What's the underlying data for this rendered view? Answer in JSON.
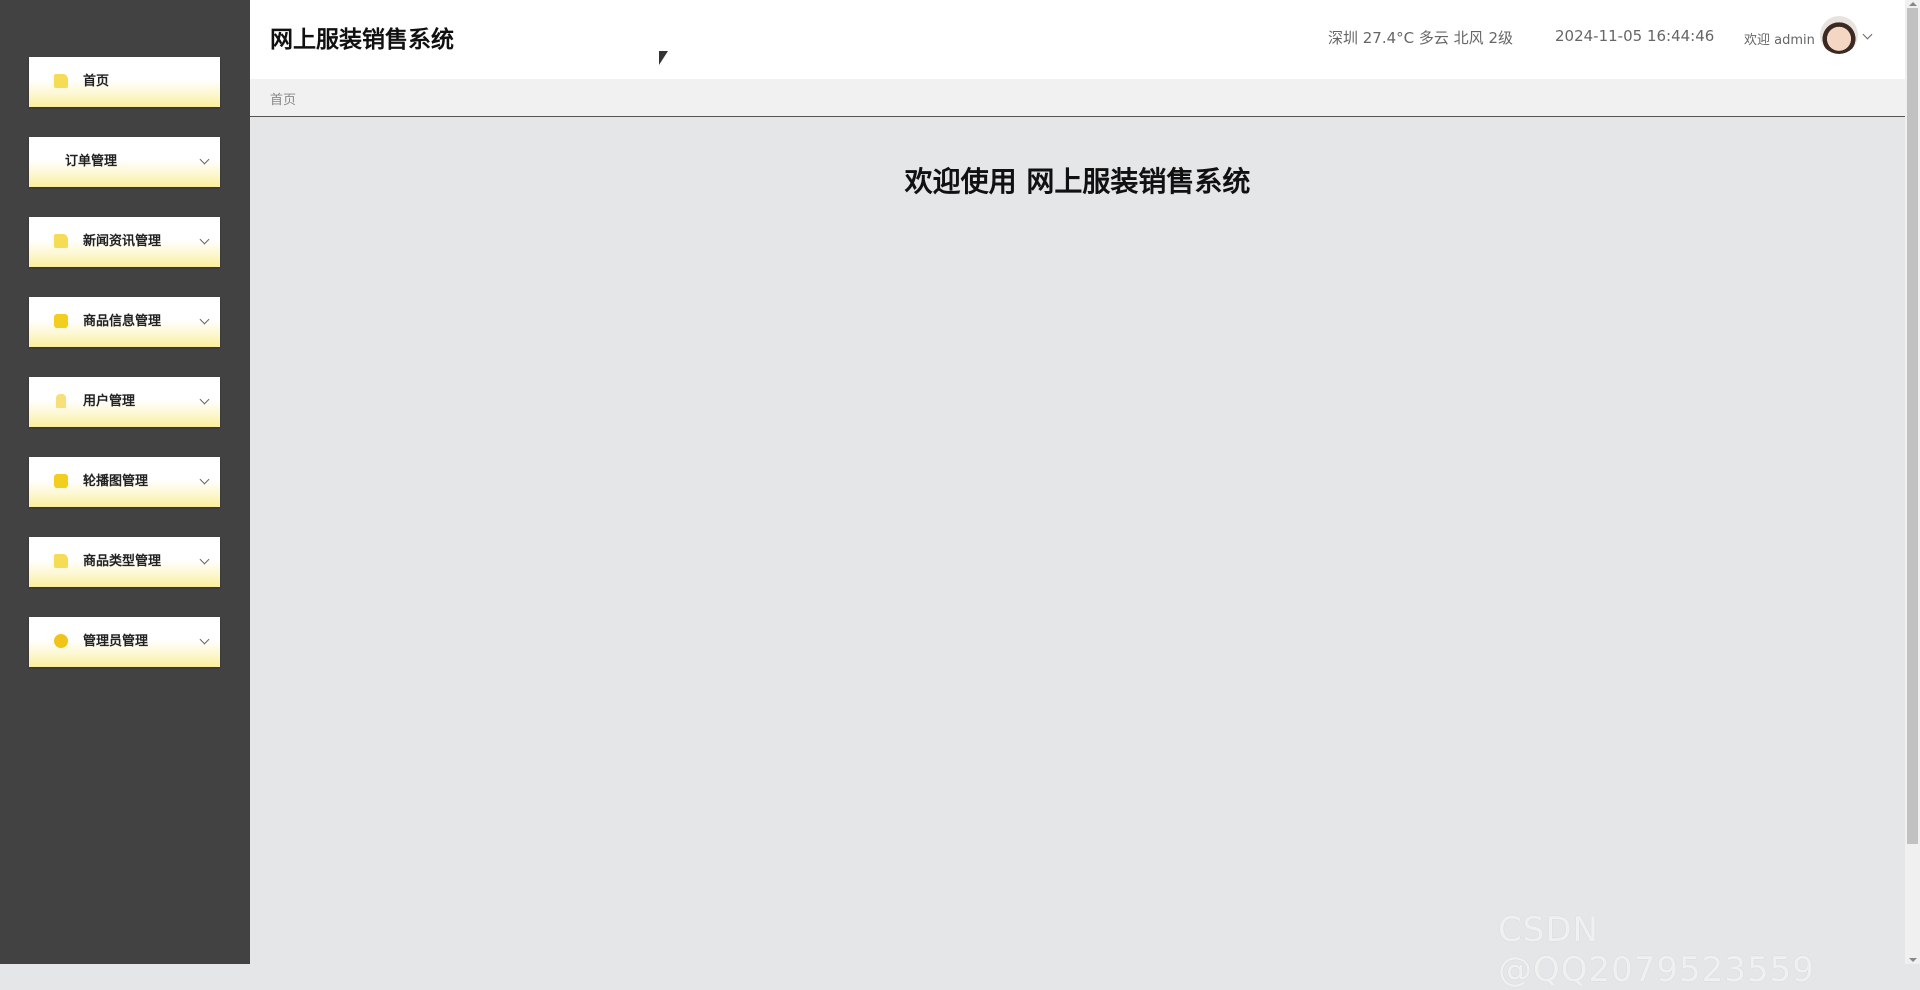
{
  "sidebar": {
    "items": [
      {
        "label": "首页",
        "icon": "folder-icon",
        "has_submenu": false
      },
      {
        "label": "订单管理",
        "icon": "",
        "has_submenu": true
      },
      {
        "label": "新闻资讯管理",
        "icon": "folder-icon",
        "has_submenu": true
      },
      {
        "label": "商品信息管理",
        "icon": "inbox-icon",
        "has_submenu": true
      },
      {
        "label": "用户管理",
        "icon": "user-icon",
        "has_submenu": true
      },
      {
        "label": "轮播图管理",
        "icon": "image-icon",
        "has_submenu": true
      },
      {
        "label": "商品类型管理",
        "icon": "folder-icon",
        "has_submenu": true
      },
      {
        "label": "管理员管理",
        "icon": "coin-icon",
        "has_submenu": true
      }
    ]
  },
  "header": {
    "title": "网上服装销售系统",
    "weather": "深圳 27.4°C 多云 北风 2级",
    "datetime": "2024-11-05 16:44:46",
    "welcome": "欢迎 admin"
  },
  "breadcrumb": {
    "current": "首页"
  },
  "main": {
    "heading": "欢迎使用 网上服装销售系统"
  },
  "watermark": "CSDN @QQ2079523559",
  "colors": {
    "sidebar_bg": "#424242",
    "menu_gradient_end": "#fbef9a",
    "content_bg": "#e4e6e7"
  }
}
